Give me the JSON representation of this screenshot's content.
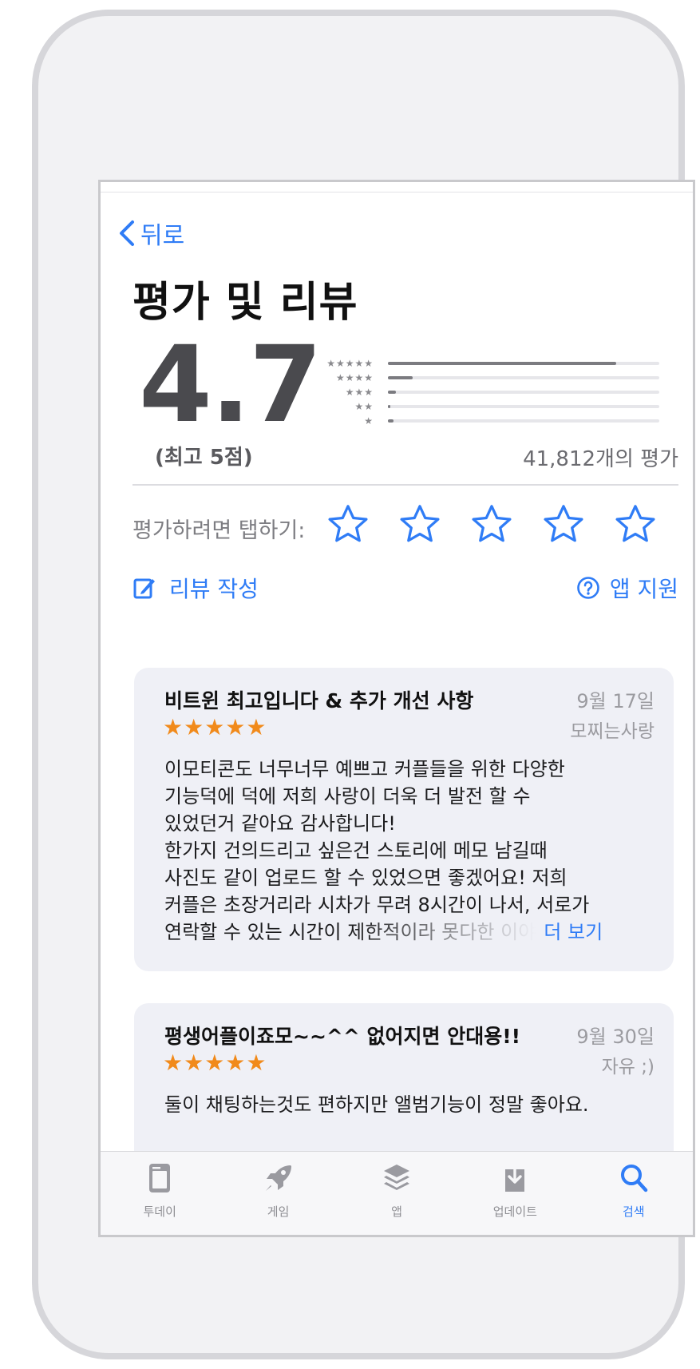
{
  "nav": {
    "back_label": "뒤로"
  },
  "page": {
    "title": "평가 및 리뷰"
  },
  "rating": {
    "score": "4.7",
    "out_of": "(최고 5점)",
    "count_text": "41,812개의 평가",
    "distribution": [
      {
        "stars": "★★★★★",
        "fraction": 0.84
      },
      {
        "stars": "★★★★",
        "fraction": 0.09
      },
      {
        "stars": "★★★",
        "fraction": 0.03
      },
      {
        "stars": "★★",
        "fraction": 0.01
      },
      {
        "stars": "★",
        "fraction": 0.02
      }
    ]
  },
  "tap_to_rate": {
    "label": "평가하려면 탭하기:",
    "star_count": 5
  },
  "actions": {
    "write_review": "리뷰 작성",
    "app_support": "앱 지원"
  },
  "reviews": [
    {
      "title": "비트윈 최고입니다 & 추가 개선 사항",
      "date": "9월 17일",
      "author": "모찌는사랑",
      "stars": "★★★★★",
      "lines": [
        "이모티콘도 너무너무 예쁘고 커플들을 위한 다양한",
        "기능덕에 덕에 저희 사랑이 더욱 더 발전 할 수",
        "있었던거 같아요 감사합니다!",
        "한가지 건의드리고 싶은건 스토리에 메모 남길때",
        "사진도 같이 업로드 할 수 있었으면 좋겠어요! 저희",
        "커플은 초장거리라 시차가 무려 8시간이 나서, 서로가"
      ],
      "last_line": "연락할 수 있는 시간이 제한적이라 못다한 이야",
      "more_label": "더 보기"
    },
    {
      "title": "평생어플이죠모~~^^ 없어지면 안대용!!",
      "date": "9월 30일",
      "author": "자유 ;)",
      "stars": "★★★★★",
      "lines": [
        "둘이 채팅하는것도 편하지만 앨범기능이 정말 좋아요."
      ]
    }
  ],
  "tabbar": {
    "items": [
      {
        "label": "투데이",
        "icon": "today-icon"
      },
      {
        "label": "게임",
        "icon": "rocket-icon"
      },
      {
        "label": "앱",
        "icon": "layers-icon"
      },
      {
        "label": "업데이트",
        "icon": "download-icon"
      },
      {
        "label": "검색",
        "icon": "search-icon"
      }
    ],
    "active": "검색"
  },
  "colors": {
    "accent": "#2f7cf6",
    "star_orange": "#f18a1b",
    "card_bg": "#eff0f6"
  }
}
